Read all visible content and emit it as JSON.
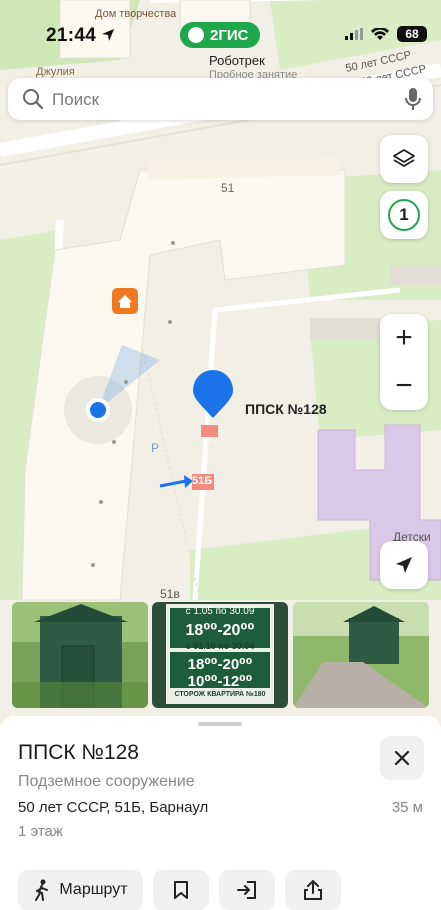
{
  "status_bar": {
    "time": "21:44",
    "brand": "2ГИС",
    "battery": "68"
  },
  "search": {
    "placeholder": "Поиск"
  },
  "map": {
    "top_labels": [
      "Дом творчества",
      "Джулия",
      "Роботрек",
      "Пробное занятие",
      "50 лет СССР",
      "50 лет СССР"
    ],
    "house_numbers": [
      "51",
      "51Б",
      "51в"
    ],
    "parking": "P",
    "kindergarten": "Детски",
    "selected_place": "ППСК №128",
    "counter": "1",
    "zoom_in": "+",
    "zoom_out": "−"
  },
  "photos": {
    "sign": {
      "line1": "с 1.05 по 30.09",
      "line2": "18⁰⁰-20⁰⁰",
      "line3": "с 01.10 по 30.04",
      "line4": "18⁰⁰-20⁰⁰",
      "line5": "10⁰⁰-12⁰⁰",
      "footer": "СТОРОЖ КВАРТИРА №180"
    }
  },
  "place": {
    "title": "ППСК №128",
    "category": "Подземное сооружение",
    "address": "50 лет СССР, 51Б, Барнаул",
    "distance": "35 м",
    "floors": "1 этаж"
  },
  "actions": {
    "route_label": "Маршрут"
  },
  "colors": {
    "brand": "#1fa74b",
    "marker": "#1a73e8",
    "building": "#fbf8ef",
    "park": "#d9ecc3"
  }
}
